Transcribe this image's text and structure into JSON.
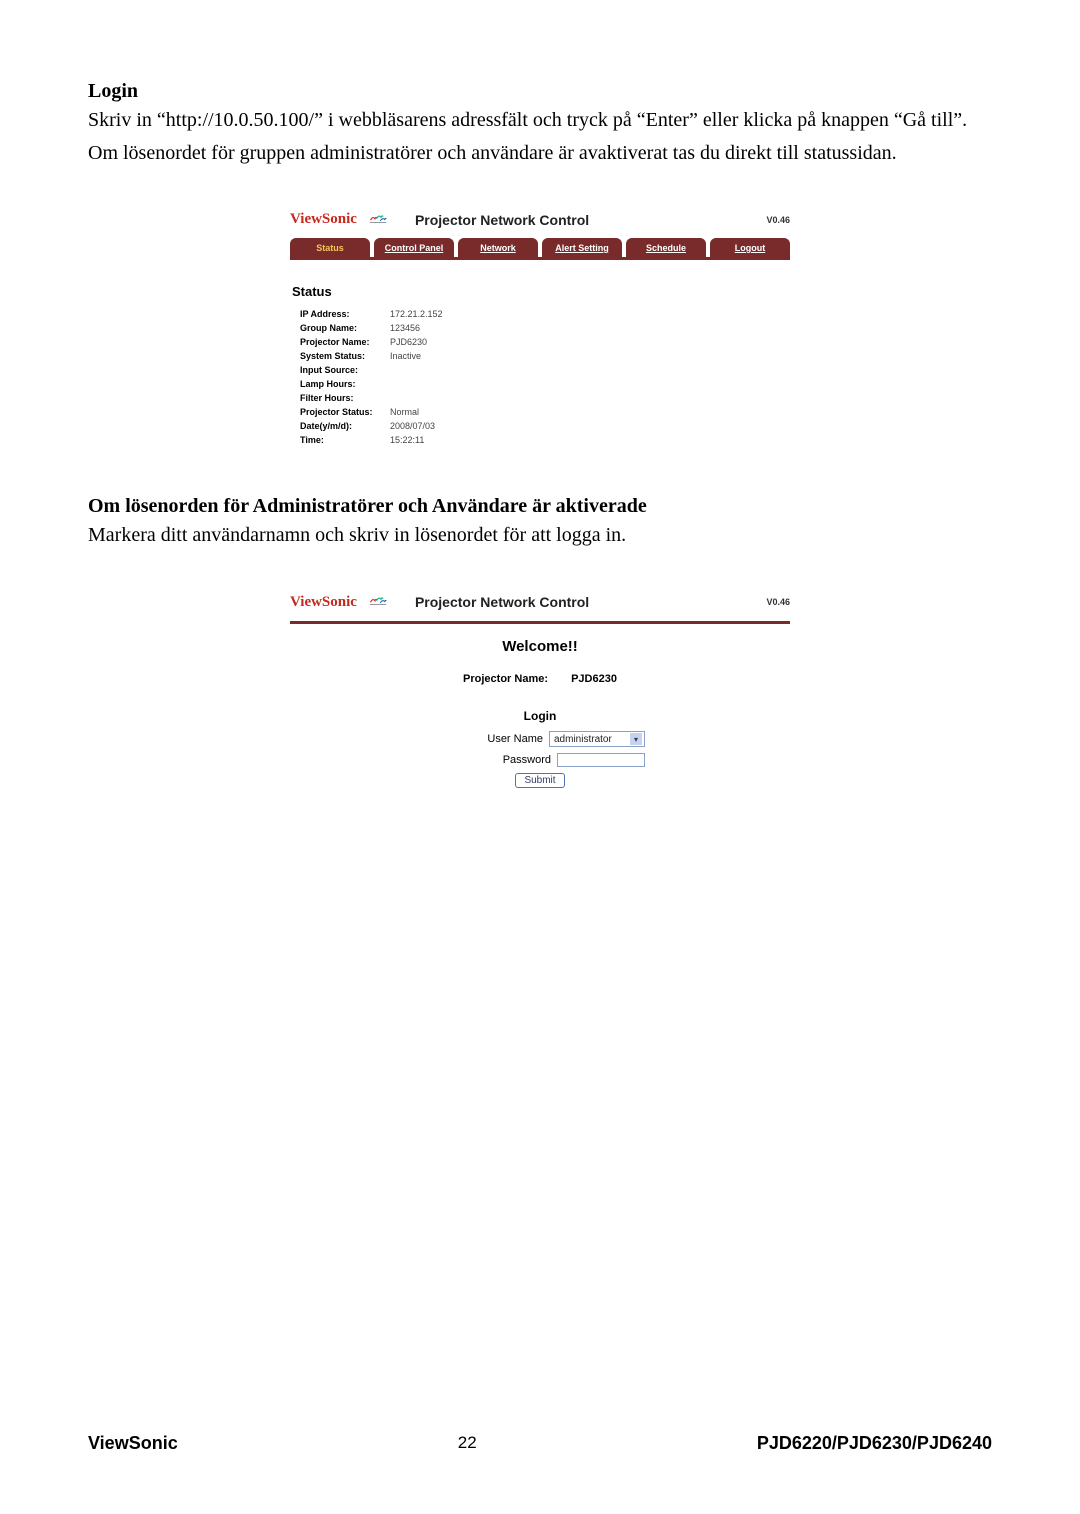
{
  "doc": {
    "h_login": "Login",
    "para1": "Skriv in “http://10.0.50.100/” i webbläsarens adressfält och tryck på “Enter” eller klicka på knappen “Gå till”.",
    "para2": "Om lösenordet för gruppen administratörer och användare är avaktiverat tas du direkt till statussidan.",
    "h_pass": "Om lösenorden för Administratörer och Användare är aktiverade",
    "para3": "Markera ditt användarnamn och skriv in lösenordet för att logga in."
  },
  "shot": {
    "brand": "ViewSonic",
    "title": "Projector Network Control",
    "version": "V0.46",
    "tabs": [
      "Status",
      "Control Panel",
      "Network",
      "Alert Setting",
      "Schedule",
      "Logout"
    ],
    "status_heading": "Status",
    "status_rows": [
      {
        "label": "IP Address:",
        "value": "172.21.2.152"
      },
      {
        "label": "Group Name:",
        "value": "123456"
      },
      {
        "label": "Projector Name:",
        "value": "PJD6230"
      },
      {
        "label": "System Status:",
        "value": "Inactive"
      },
      {
        "label": "Input Source:",
        "value": ""
      },
      {
        "label": "Lamp Hours:",
        "value": ""
      },
      {
        "label": "Filter Hours:",
        "value": ""
      },
      {
        "label": "Projector Status:",
        "value": "Normal"
      },
      {
        "label": "Date(y/m/d):",
        "value": "2008/07/03"
      },
      {
        "label": "Time:",
        "value": "15:22:11"
      }
    ]
  },
  "shot2": {
    "welcome": "Welcome!!",
    "projector_label": "Projector Name:",
    "projector_name": "PJD6230",
    "login_label": "Login",
    "username_label": "User Name",
    "username_value": "administrator",
    "password_label": "Password",
    "password_value": "",
    "submit_label": "Submit"
  },
  "footer": {
    "left": "ViewSonic",
    "center": "22",
    "right": "PJD6220/PJD6230/PJD6240"
  }
}
